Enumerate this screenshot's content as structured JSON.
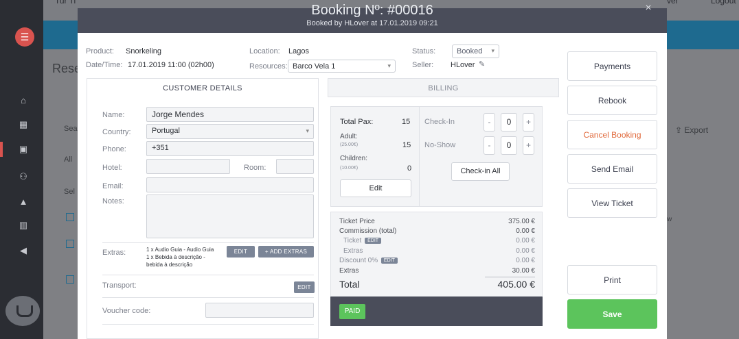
{
  "background": {
    "partial_top_text": "Tur Ti",
    "reservations_partial": "Rese",
    "search_partial": "Sea",
    "all_partial": "All",
    "sel_partial": "Sel",
    "export_label": "Export",
    "logout_label": "Logout",
    "user_partial": "ver",
    "col_partial": "w"
  },
  "modal": {
    "title": "Booking Nº: #00016",
    "subtitle": "Booked by HLover at 17.01.2019 09:21",
    "close_icon": "×",
    "product_label": "Product:",
    "product_value": "Snorkeling",
    "datetime_label": "Date/Time:",
    "datetime_value": "17.01.2019 11:00 (02h00)",
    "location_label": "Location:",
    "location_value": "Lagos",
    "resources_label": "Resources:",
    "resources_value": "Barco Vela 1",
    "status_label": "Status:",
    "status_value": "Booked",
    "seller_label": "Seller:",
    "seller_value": "HLover"
  },
  "tabs": [
    {
      "label": "CUSTOMER DETAILS",
      "active": true
    },
    {
      "label": "BILLING",
      "active": false
    }
  ],
  "customer": {
    "name_label": "Name:",
    "name_value": "Jorge Mendes",
    "country_label": "Country:",
    "country_value": "Portugal",
    "phone_label": "Phone:",
    "phone_value": "+351",
    "hotel_label": "Hotel:",
    "hotel_value": "",
    "room_label": "Room:",
    "room_value": "",
    "email_label": "Email:",
    "email_value": "",
    "notes_label": "Notes:",
    "notes_value": "",
    "extras_label": "Extras:",
    "extras_lines": [
      "1 x Audio Guia - Audio Guia",
      "1 x Bebida à descrição -",
      "bebida à descrição"
    ],
    "extras_edit": "EDIT",
    "add_extras": "+ ADD EXTRAS",
    "transport_label": "Transport:",
    "transport_edit": "EDIT",
    "voucher_label": "Voucher code:",
    "voucher_value": ""
  },
  "pax": {
    "total_label": "Total Pax:",
    "total_value": "15",
    "adult_label": "Adult:",
    "adult_price": "(25.00€)",
    "adult_value": "15",
    "children_label": "Children:",
    "children_price": "(10.00€)",
    "children_value": "0",
    "edit_label": "Edit",
    "checkin_label": "Check-In",
    "checkin_value": "0",
    "noshow_label": "No-Show",
    "noshow_value": "0",
    "minus": "-",
    "plus": "+",
    "checkin_all": "Check-in All"
  },
  "pricing": {
    "ticket_price_label": "Ticket Price",
    "ticket_price_value": "375.00 €",
    "commission_label": "Commission (total)",
    "commission_value": "0.00 €",
    "ticket_label": "Ticket",
    "ticket_value": "0.00 €",
    "extras_sub_label": "Extras",
    "extras_sub_value": "0.00 €",
    "discount_label": "Discount 0%",
    "discount_value": "0.00 €",
    "extras_label": "Extras",
    "extras_value": "30.00 €",
    "total_label": "Total",
    "total_value": "405.00 €",
    "edit_pill": "EDIT",
    "paid_label": "PAID"
  },
  "actions": {
    "payments": "Payments",
    "rebook": "Rebook",
    "cancel": "Cancel Booking",
    "send_email": "Send Email",
    "view_ticket": "View Ticket",
    "print": "Print",
    "save": "Save"
  },
  "colors": {
    "modal_header": "#4a4d5a",
    "cancel_text": "#e0693b",
    "save_bg": "#5cc45c",
    "paid_bg": "#5cc45c",
    "brand_blue": "#1e6a8f"
  }
}
